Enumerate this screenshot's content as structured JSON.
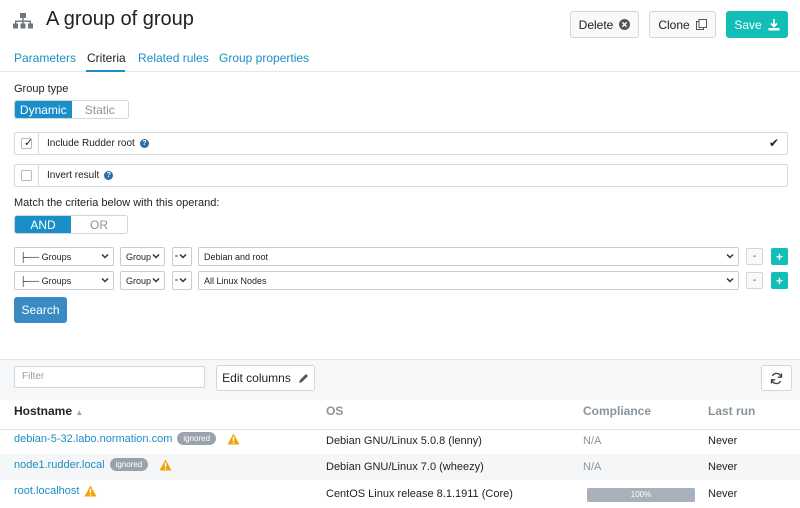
{
  "header": {
    "title": "A group of group",
    "icon": "group-icon",
    "delete_label": "Delete",
    "clone_label": "Clone",
    "save_label": "Save"
  },
  "tabs": [
    "Parameters",
    "Criteria",
    "Related rules",
    "Group properties"
  ],
  "active_tab": "Criteria",
  "group_type": {
    "label": "Group type",
    "options": [
      "Dynamic",
      "Static"
    ],
    "selected": "Dynamic"
  },
  "include_root": {
    "label": "Include Rudder root",
    "checked": true
  },
  "invert_result": {
    "label": "Invert result",
    "checked": false
  },
  "operand": {
    "label": "Match the criteria below with this operand:",
    "options": [
      "AND",
      "OR"
    ],
    "selected": "AND"
  },
  "criteria": [
    {
      "object": "├── Groups",
      "attribute": "Group",
      "comparator": "=",
      "value": "Debian and root"
    },
    {
      "object": "├── Groups",
      "attribute": "Group",
      "comparator": "=",
      "value": "All Linux Nodes"
    }
  ],
  "search_label": "Search",
  "results": {
    "filter_placeholder": "Filter",
    "edit_columns_label": "Edit columns",
    "columns": [
      "Hostname",
      "OS",
      "Compliance",
      "Last run"
    ],
    "rows": [
      {
        "hostname": "debian-5-32.labo.normation.com",
        "badge": "ignored",
        "warning": true,
        "os": "Debian GNU/Linux 5.0.8 (lenny)",
        "compliance": "N/A",
        "last_run": "Never"
      },
      {
        "hostname": "node1.rudder.local",
        "badge": "ignored",
        "warning": true,
        "os": "Debian GNU/Linux 7.0 (wheezy)",
        "compliance": "N/A",
        "last_run": "Never"
      },
      {
        "hostname": "root.localhost",
        "badge": "",
        "warning": true,
        "os": "CentOS Linux release 8.1.1911 (Core)",
        "compliance": "100%",
        "compliance_value": 100,
        "last_run": "Never"
      }
    ]
  },
  "colors": {
    "accent": "#1a8fc7",
    "save": "#13beb7",
    "warning": "#f0a30a",
    "badge": "#9aa3ab"
  }
}
